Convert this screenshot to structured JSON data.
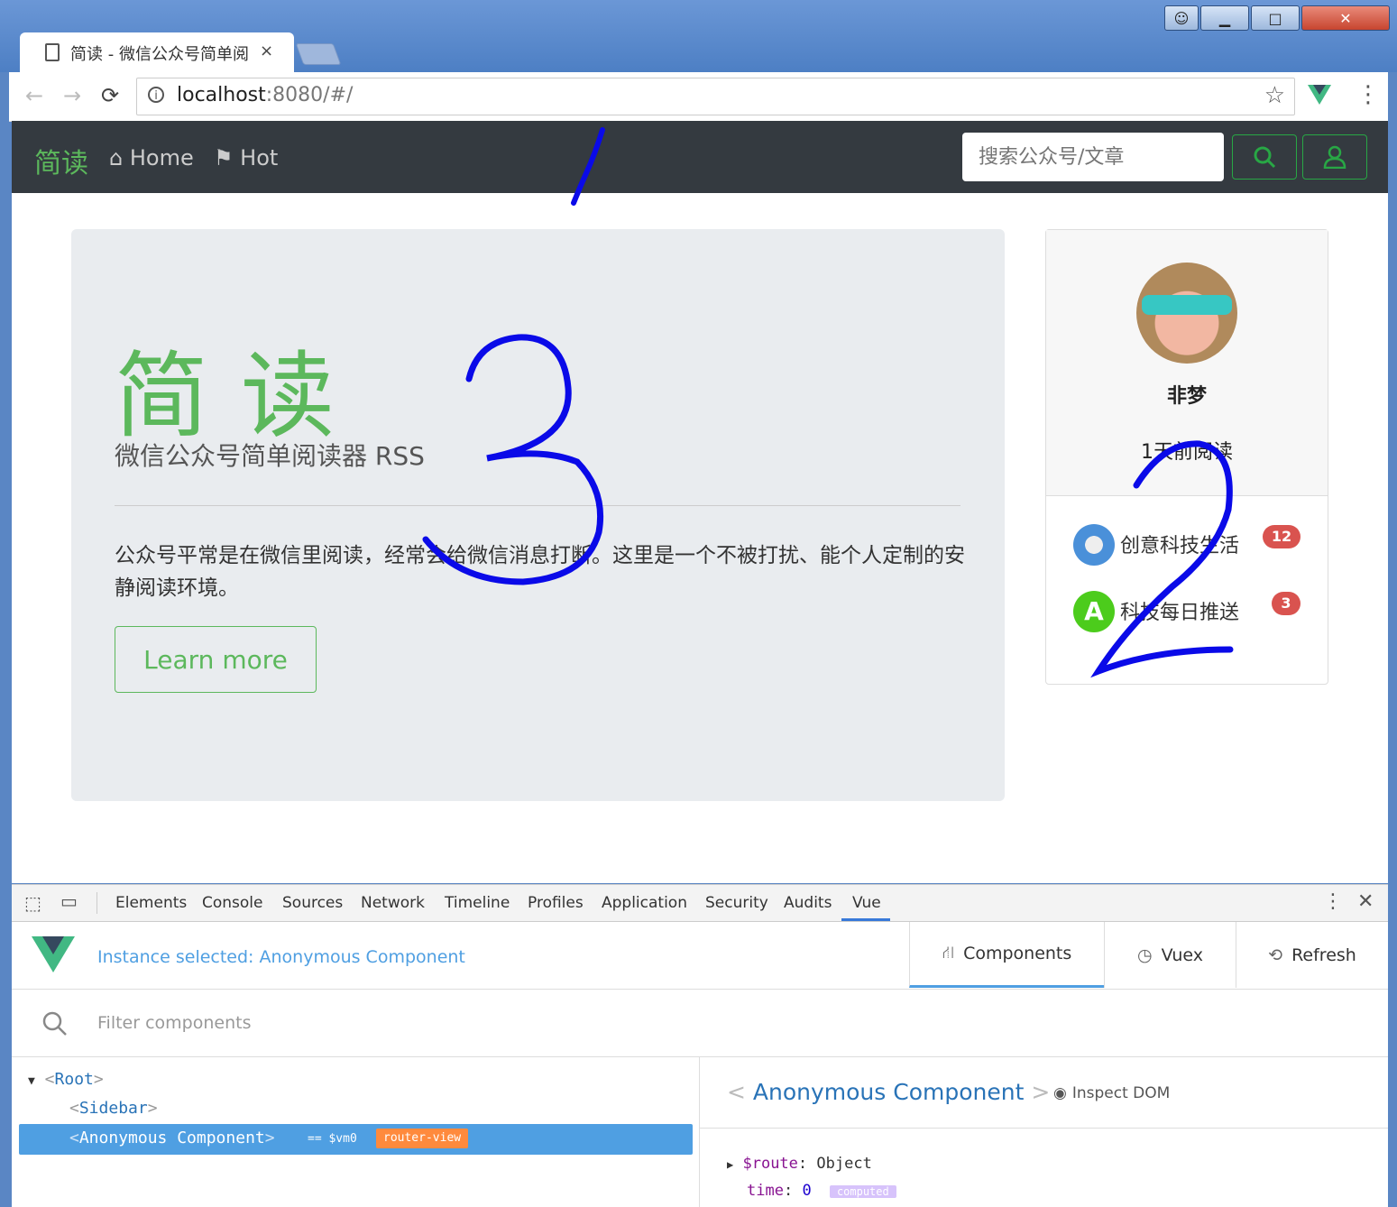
{
  "browser": {
    "tab_title": "简读 - 微信公众号简单阅",
    "tab_close": "×",
    "url_host": "localhost",
    "url_rest": ":8080/#/",
    "back": "←",
    "forward": "→",
    "reload": "⟳",
    "star": "☆",
    "menu": "⋮"
  },
  "navbar": {
    "brand": "简读",
    "links": [
      {
        "icon": "home-icon",
        "label": "Home"
      },
      {
        "icon": "flag-icon",
        "label": "Hot"
      }
    ],
    "search_placeholder": "搜索公众号/文章"
  },
  "jumbotron": {
    "title": "简读",
    "subtitle": "微信公众号简单阅读器 RSS",
    "text": "公众号平常是在微信里阅读，经常会给微信消息打断。这里是一个不被打扰、能个人定制的安静阅读环境。",
    "button": "Learn more"
  },
  "profile": {
    "name": "非梦",
    "stat": "1天前阅读",
    "subscriptions": [
      {
        "name": "创意科技生活",
        "count": "12"
      },
      {
        "name": "科技每日推送",
        "count": "3"
      }
    ]
  },
  "annotations": [
    "1",
    "2",
    "3"
  ],
  "devtools": {
    "tabs": [
      "Elements",
      "Console",
      "Sources",
      "Network",
      "Timeline",
      "Profiles",
      "Application",
      "Security",
      "Audits",
      "Vue"
    ],
    "active_tab": "Vue",
    "vue": {
      "instance_selected": "Instance selected: Anonymous Component",
      "view_tabs": [
        "Components",
        "Vuex",
        "Refresh"
      ],
      "filter_placeholder": "Filter components",
      "tree": {
        "root": "Root",
        "sidebar": "Sidebar",
        "selected": "Anonymous Component",
        "vm": "== $vm0",
        "tag": "router-view"
      },
      "detail": {
        "component_name": "Anonymous Component",
        "inspect": "Inspect DOM",
        "route_key": "$route",
        "route_val": "Object",
        "time_key": "time",
        "time_val": "0",
        "computed": "computed"
      }
    }
  },
  "colors": {
    "brand_green": "#5cb85c",
    "navbar_bg": "#343a40",
    "badge_red": "#d9534f",
    "vue_blue": "#4f9fe2",
    "scribble_blue": "#0a0ae8"
  }
}
